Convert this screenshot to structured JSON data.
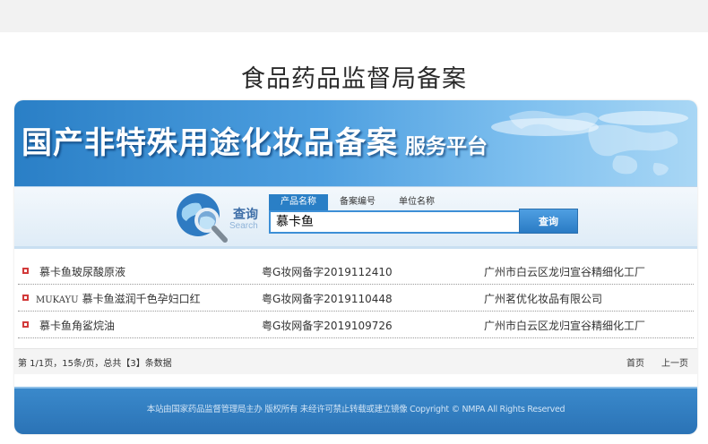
{
  "page": {
    "heading": "食品药品监督局备案"
  },
  "banner": {
    "title": "国产非特殊用途化妆品备案",
    "subtitle": "服务平台"
  },
  "search": {
    "label_cn": "查询",
    "label_en": "Search",
    "tabs": [
      {
        "label": "产品名称",
        "active": true
      },
      {
        "label": "备案编号",
        "active": false
      },
      {
        "label": "单位名称",
        "active": false
      }
    ],
    "query": "慕卡鱼",
    "button_label": "查询"
  },
  "results": [
    {
      "brand": "",
      "name": "慕卡鱼玻尿酸原液",
      "code": "粤G妆网备字2019112410",
      "company": "广州市白云区龙归宣谷精细化工厂"
    },
    {
      "brand": "MUKAYU",
      "name": "慕卡鱼滋润千色孕妇口红",
      "code": "粤G妆网备字2019110448",
      "company": "广州茗优化妆品有限公司"
    },
    {
      "brand": "",
      "name": "慕卡鱼角鲨烷油",
      "code": "粤G妆网备字2019109726",
      "company": "广州市白云区龙归宣谷精细化工厂"
    }
  ],
  "pager": {
    "summary": "第 1/1页，15条/页，总共【3】条数据",
    "first": "首页",
    "prev": "上一页"
  },
  "footer": {
    "text": "本站由国家药品监督管理局主办 版权所有 未经许可禁止转载或建立镜像 Copyright © NMPA All Rights Reserved"
  },
  "colors": {
    "accent": "#2a7fc6",
    "bullet": "#d23a3a"
  }
}
